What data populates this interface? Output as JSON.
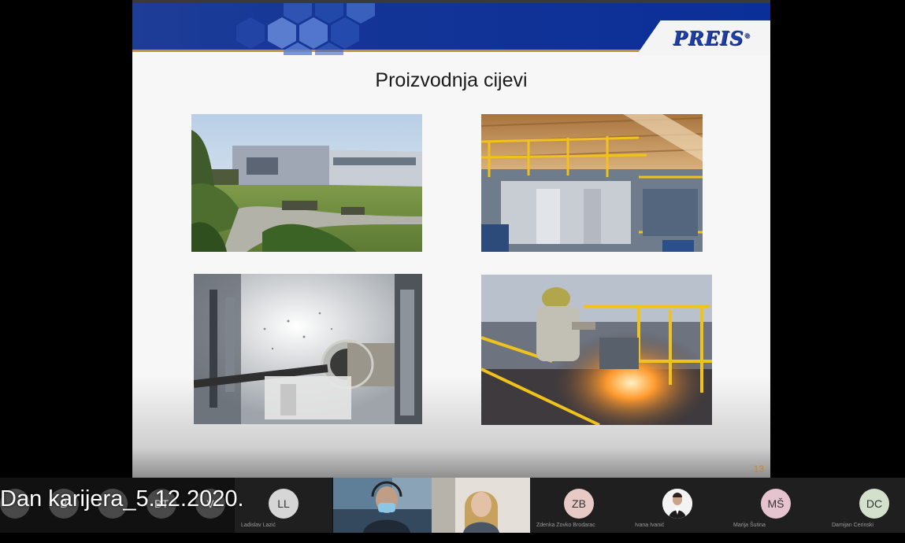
{
  "slide": {
    "title": "Proizvodnja cijevi",
    "brand": "PREIS",
    "brand_mark": "®",
    "page_number": "13",
    "photos": [
      {
        "subject": "factory-building-photo"
      },
      {
        "subject": "industrial-plant-interior-photo"
      },
      {
        "subject": "pipe-cutting-photo"
      },
      {
        "subject": "steel-worker-photo"
      }
    ]
  },
  "meeting": {
    "overlay_title": "Dan karijera_5.12.2020.",
    "ghost_initials": [
      "",
      "B",
      "BT",
      "V"
    ],
    "participants": [
      {
        "initials": "LL",
        "name": "Ladislav Lazić",
        "type": "avatar",
        "avatar_color": "#d6d6d6"
      },
      {
        "initials": "",
        "name": "",
        "type": "video-man"
      },
      {
        "initials": "",
        "name": "",
        "type": "video-woman"
      },
      {
        "initials": "ZB",
        "name": "Zdenka Zovko Brodarac",
        "type": "avatar",
        "avatar_color": "#e7c9c6"
      },
      {
        "initials": "",
        "name": "Ivana Ivanić",
        "type": "photo"
      },
      {
        "initials": "MŠ",
        "name": "Marija Šutina",
        "type": "avatar",
        "avatar_color": "#e6c4cf"
      },
      {
        "initials": "DC",
        "name": "Damijan Cerinski",
        "type": "avatar",
        "avatar_color": "#d2e0cc"
      }
    ]
  }
}
